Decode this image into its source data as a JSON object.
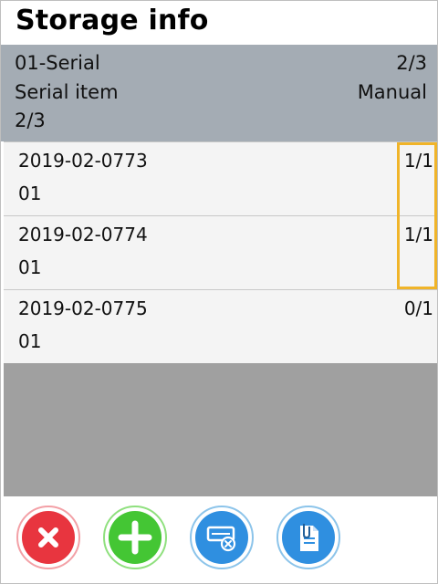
{
  "title": "Storage info",
  "header": {
    "row1_left": "01-Serial",
    "row1_right": "2/3",
    "row2_left": "Serial item",
    "row2_right": "Manual",
    "row3_left": "2/3"
  },
  "items": [
    {
      "id": "2019-02-0773",
      "code": "01",
      "qty": "1/1"
    },
    {
      "id": "2019-02-0774",
      "code": "01",
      "qty": "1/1"
    },
    {
      "id": "2019-02-0775",
      "code": "01",
      "qty": "0/1"
    }
  ],
  "footer": {
    "buttons": [
      "cancel-icon",
      "add-icon",
      "remove-item-icon",
      "document-attach-icon"
    ]
  },
  "colors": {
    "header_bg": "#a4acb4",
    "highlight": "#f0b429",
    "cancel": "#e8353f",
    "add": "#44c634",
    "action_blue": "#2f8fe0"
  }
}
